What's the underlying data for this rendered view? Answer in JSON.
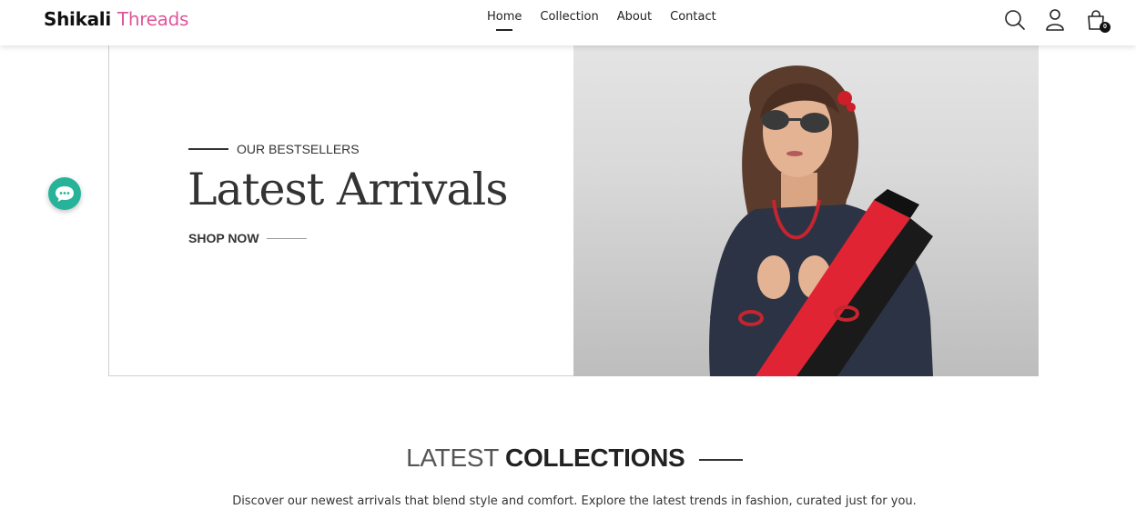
{
  "brand": {
    "part1": "Shikali",
    "part2": "Threads",
    "accent_color": "#e0569a"
  },
  "nav": {
    "items": [
      "Home",
      "Collection",
      "About",
      "Contact"
    ],
    "active": "Home"
  },
  "header_icons": {
    "search": "search-icon",
    "account": "user-icon",
    "cart": "shopping-bag-icon",
    "cart_count": "0"
  },
  "hero": {
    "eyebrow": "OUR BESTSELLERS",
    "title": "Latest Arrivals",
    "cta": "SHOP NOW"
  },
  "chat": {
    "icon": "chat-bubble-icon",
    "color": "#26b39a"
  },
  "collections": {
    "title_light": "LATEST",
    "title_bold": "COLLECTIONS",
    "description": "Discover our newest arrivals that blend style and comfort. Explore the latest trends in fashion, curated just for you."
  }
}
